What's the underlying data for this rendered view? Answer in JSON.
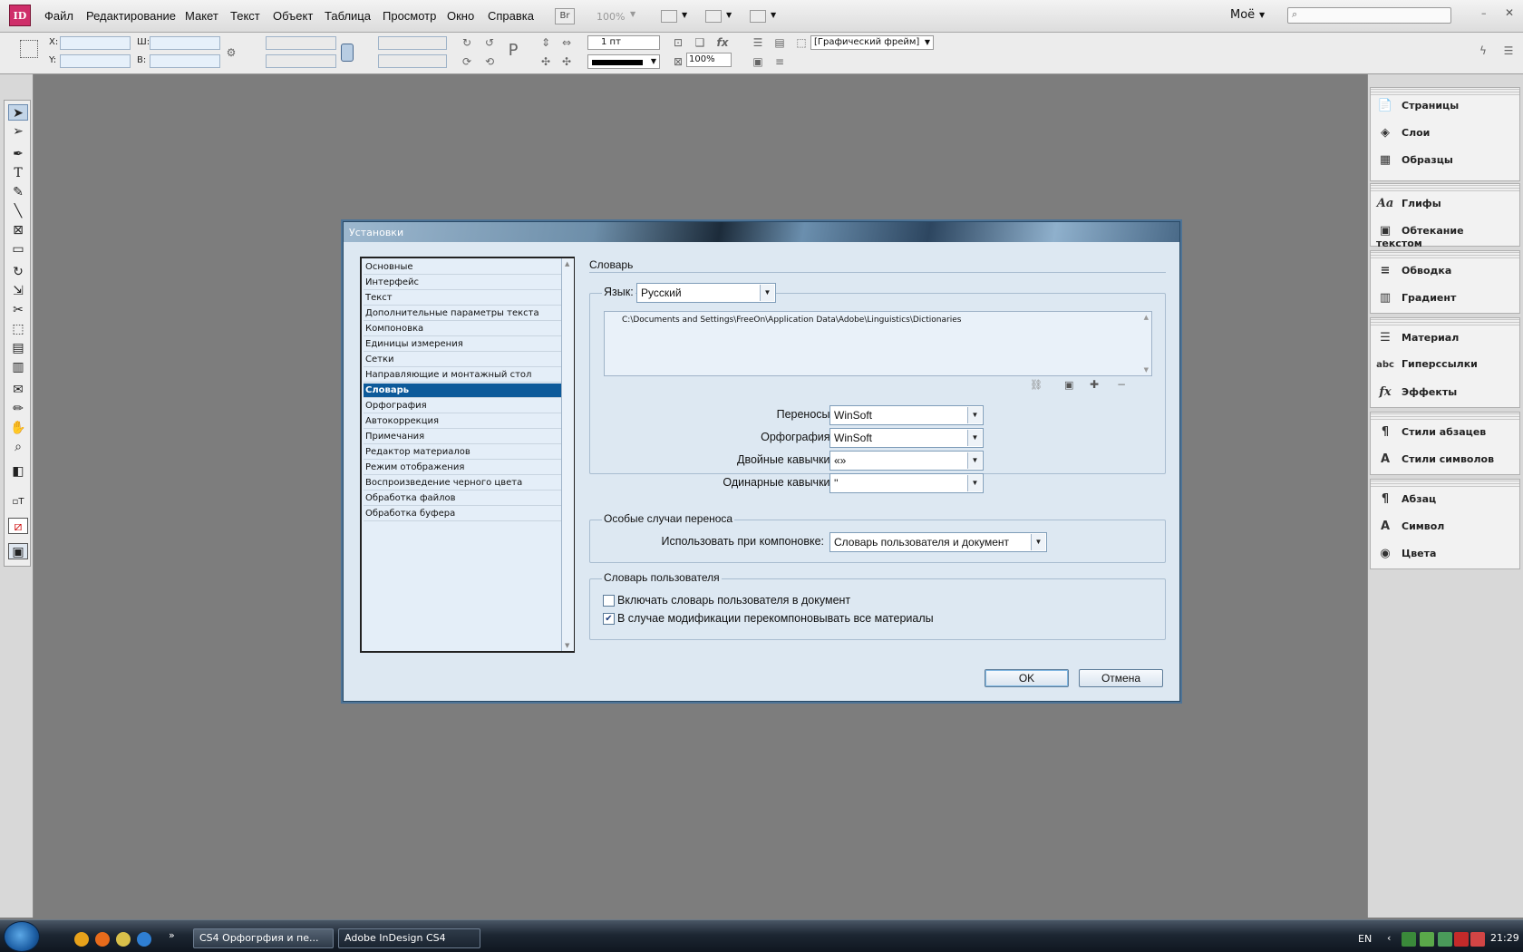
{
  "app": {
    "logo": "ID"
  },
  "menu": [
    "Файл",
    "Редактирование",
    "Макет",
    "Текст",
    "Объект",
    "Таблица",
    "Просмотр",
    "Окно",
    "Справка"
  ],
  "toolbar": {
    "bridge": "Br",
    "zoom": "100%",
    "workspace": "Моё"
  },
  "control": {
    "x_label": "X:",
    "y_label": "Y:",
    "w_label": "Ш:",
    "h_label": "В:",
    "stroke_weight": "1 пт",
    "scale": "100%",
    "frame_type": "[Графический фрейм]"
  },
  "panels": [
    {
      "items": [
        {
          "icon": "pages-icon",
          "label": "Страницы"
        },
        {
          "icon": "layers-icon",
          "label": "Слои"
        },
        {
          "icon": "swatches-icon",
          "label": "Образцы"
        }
      ]
    },
    {
      "items": [
        {
          "icon": "glyphs-icon",
          "label": "Глифы"
        },
        {
          "icon": "text-wrap-icon",
          "label": "Обтекание текстом"
        }
      ]
    },
    {
      "items": [
        {
          "icon": "stroke-icon",
          "label": "Обводка"
        },
        {
          "icon": "gradient-icon",
          "label": "Градиент"
        }
      ]
    },
    {
      "items": [
        {
          "icon": "story-icon",
          "label": "Материал"
        },
        {
          "icon": "hyperlinks-icon",
          "label": "Гиперссылки"
        },
        {
          "icon": "effects-icon",
          "label": "Эффекты"
        }
      ]
    },
    {
      "items": [
        {
          "icon": "paragraph-styles-icon",
          "label": "Стили абзацев"
        },
        {
          "icon": "character-styles-icon",
          "label": "Стили символов"
        }
      ]
    },
    {
      "items": [
        {
          "icon": "paragraph-icon",
          "label": "Абзац"
        },
        {
          "icon": "character-icon",
          "label": "Символ"
        },
        {
          "icon": "color-icon",
          "label": "Цвета"
        }
      ]
    }
  ],
  "dialog": {
    "title": "Установки",
    "categories": [
      "Основные",
      "Интерфейс",
      "Текст",
      "Дополнительные параметры текста",
      "Компоновка",
      "Единицы измерения",
      "Сетки",
      "Направляющие и монтажный стол",
      "Словарь",
      "Орфография",
      "Автокоррекция",
      "Примечания",
      "Редактор материалов",
      "Режим отображения",
      "Воспроизведение черного цвета",
      "Обработка файлов",
      "Обработка буфера"
    ],
    "selected_index": 8,
    "section_title": "Словарь",
    "language_label": "Язык:",
    "language_value": "Русский",
    "dictionary_path": "C:\\Documents and Settings\\FreeOn\\Application Data\\Adobe\\Linguistics\\Dictionaries",
    "hyphenation_label": "Переносы:",
    "hyphenation_value": "WinSoft",
    "spelling_label": "Орфография:",
    "spelling_value": "WinSoft",
    "double_quotes_label": "Двойные кавычки:",
    "double_quotes_value": "«»",
    "single_quotes_label": "Одинарные кавычки:",
    "single_quotes_value": "''",
    "exceptions_title": "Особые случаи переноса",
    "compose_using_label": "Использовать при компоновке:",
    "compose_using_value": "Словарь пользователя и документ",
    "user_dict_title": "Словарь пользователя",
    "merge_label": "Включать словарь пользователя в документ",
    "merge_checked": false,
    "recompose_label": "В случае модификации перекомпоновывать все материалы",
    "recompose_checked": true,
    "ok_label": "OK",
    "cancel_label": "Отмена"
  },
  "taskbar": {
    "tasks": [
      "CS4 Орфогрфия и пе...",
      "Adobe InDesign CS4"
    ],
    "lang": "EN",
    "clock": "21:29"
  }
}
